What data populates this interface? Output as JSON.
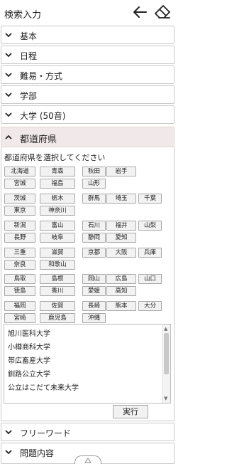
{
  "header": {
    "title": "検索入力",
    "icons": [
      "back-arrow-icon",
      "eraser-icon"
    ]
  },
  "sections_top": [
    {
      "label": "基本",
      "state": "collapsed"
    },
    {
      "label": "日程",
      "state": "collapsed"
    },
    {
      "label": "難易・方式",
      "state": "collapsed"
    },
    {
      "label": "学部",
      "state": "collapsed"
    },
    {
      "label": "大学 (50音)",
      "state": "collapsed"
    }
  ],
  "open_section": {
    "label": "都道府県",
    "state": "expanded"
  },
  "prefecture_panel": {
    "instruction": "都道府県を選択してください",
    "prefectures": [
      "北海道",
      "青森",
      "秋田",
      "岩手",
      "宮城",
      "福島",
      "山形",
      "茨城",
      "栃木",
      "群馬",
      "埼玉",
      "千葉",
      "東京",
      "神奈川",
      "新潟",
      "富山",
      "石川",
      "福井",
      "山梨",
      "長野",
      "岐阜",
      "静岡",
      "愛知",
      "三重",
      "滋賀",
      "京都",
      "大阪",
      "兵庫",
      "奈良",
      "和歌山",
      "鳥取",
      "島根",
      "岡山",
      "広島",
      "山口",
      "徳島",
      "香川",
      "愛媛",
      "高知",
      "福岡",
      "佐賀",
      "長崎",
      "熊本",
      "大分",
      "宮崎",
      "鹿児島",
      "沖縄"
    ],
    "universities": [
      "旭川医科大学",
      "小樽商科大学",
      "帯広畜産大学",
      "釧路公立大学",
      "公立はこだて未来大学"
    ],
    "execute_label": "実行"
  },
  "sections_bottom": [
    {
      "label": "フリーワード",
      "state": "collapsed"
    },
    {
      "label": "問題内容",
      "state": "collapsed"
    }
  ],
  "colors": {
    "open_section_bg": "#f1e9e9",
    "border": "#c9c9c9",
    "button_bg": "#f2f2f2"
  }
}
